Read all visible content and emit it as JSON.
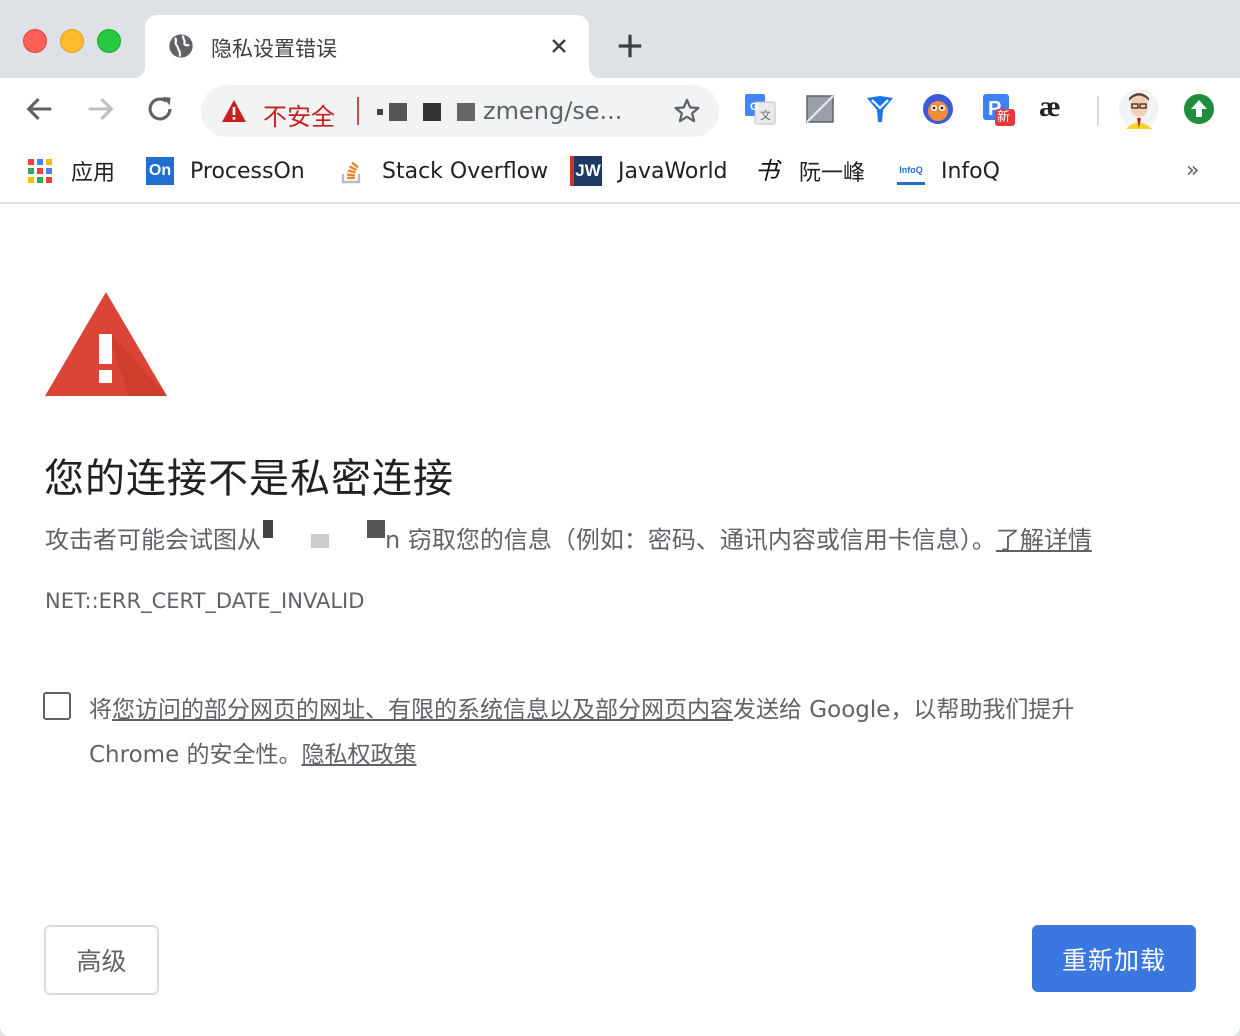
{
  "tab": {
    "title": "隐私设置错误",
    "close_icon": "close-icon",
    "favicon": "globe-icon",
    "new_tab_icon": "plus-icon"
  },
  "toolbar": {
    "security_label": "不安全",
    "url_visible": "zmeng/se...",
    "back_icon": "arrow-left-icon",
    "forward_icon": "arrow-right-icon",
    "reload_icon": "reload-icon",
    "star_icon": "star-icon",
    "extensions": [
      "google-translate-icon",
      "gray-square-icon",
      "y-shield-icon",
      "owl-avatar-icon",
      "p-new-icon",
      "ae-icon",
      "profile-avatar-icon",
      "upload-circle-icon"
    ],
    "extension_badge": "新",
    "ae_label": "æ"
  },
  "bookmarks": {
    "items": [
      {
        "label": "应用",
        "icon": "apps-grid-icon"
      },
      {
        "label": "ProcessOn",
        "icon": "processon-icon",
        "icon_text": "On"
      },
      {
        "label": "Stack Overflow",
        "icon": "stackoverflow-icon"
      },
      {
        "label": "JavaWorld",
        "icon": "javaworld-icon",
        "icon_text": "JW"
      },
      {
        "label": "阮一峰",
        "icon": "calligraphy-icon",
        "icon_text": "书"
      },
      {
        "label": "InfoQ",
        "icon": "infoq-icon",
        "icon_text": "InfoQ"
      }
    ],
    "more_label": "»"
  },
  "page": {
    "heading": "您的连接不是私密连接",
    "description_prefix": "攻击者可能会试图从",
    "description_middle": "n 窃取您的信息（例如：密码、通讯内容或信用卡信息）。",
    "learn_more": "了解详情",
    "error_code": "NET::ERR_CERT_DATE_INVALID",
    "optin_prefix": "将",
    "optin_link": "您访问的部分网页的网址、有限的系统信息以及部分网页内容",
    "optin_middle": "发送给 Google，以帮助我们提升 Chrome 的安全性。",
    "privacy_link": "隐私权政策",
    "advanced_button": "高级",
    "reload_button": "重新加载"
  },
  "colors": {
    "warning_red": "#db4437",
    "insecure_red": "#c5221f",
    "primary_blue": "#3a77e0",
    "text_gray": "#5f6368"
  }
}
